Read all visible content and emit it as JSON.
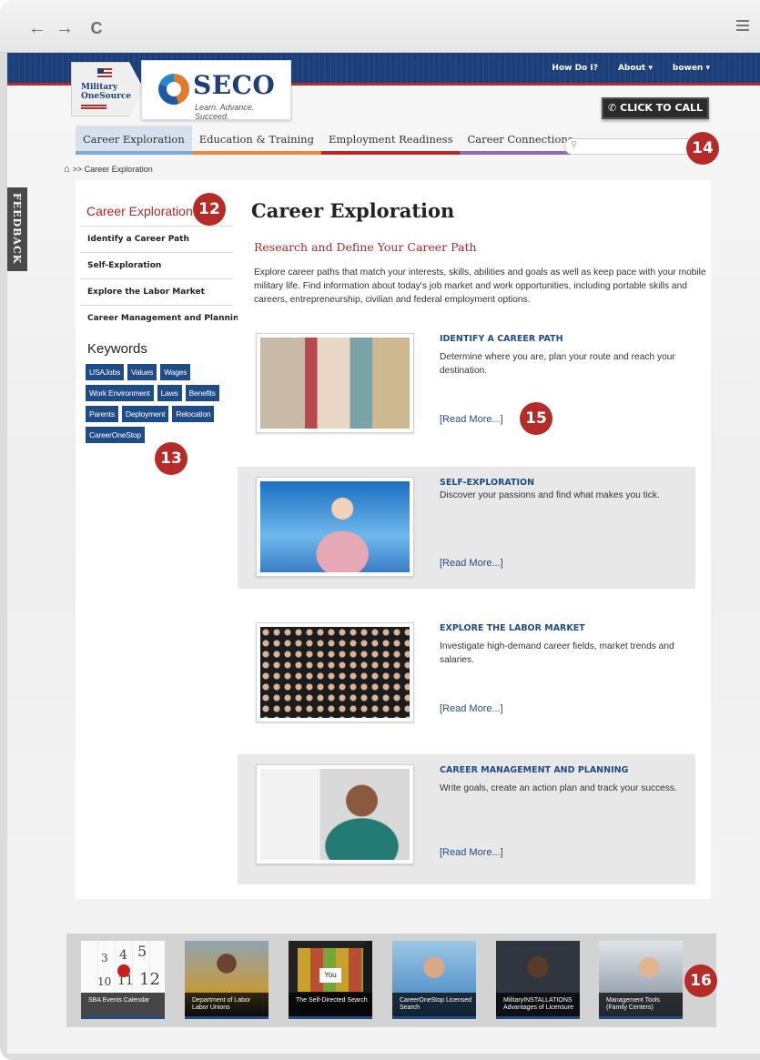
{
  "browser": {
    "back_icon": "←",
    "forward_icon": "→",
    "reload_icon": "C",
    "menu_icon": "hamburger-icon"
  },
  "topnav": {
    "how_do_i": "How Do I?",
    "about": "About ▾",
    "user": "bowen ▾"
  },
  "logos": {
    "mos_line1": "Military",
    "mos_line2": "OneSource",
    "seco_name": "SECO",
    "seco_tagline": "Learn. Advance. Succeed."
  },
  "call_button": "CLICK TO CALL",
  "tabs": [
    {
      "label": "Career Exploration",
      "color": "#7fa8d6"
    },
    {
      "label": "Education & Training",
      "color": "#e98a3a"
    },
    {
      "label": "Employment Readiness",
      "color": "#b52b27"
    },
    {
      "label": "Career Connections",
      "color": "#8e6bb3"
    }
  ],
  "search": {
    "placeholder": ""
  },
  "breadcrumb": ">> Career Exploration",
  "feedback_label": "FEEDBACK",
  "sidebar": {
    "title": "Career Exploration",
    "items": [
      "Identify a Career Path",
      "Self-Exploration",
      "Explore the Labor Market",
      "Career Management and Planning"
    ],
    "keywords_title": "Keywords",
    "keywords": [
      "USAJobs",
      "Values",
      "Wages",
      "Work Environment",
      "Laws",
      "Benefits",
      "Parents",
      "Deployment",
      "Relocation",
      "CareerOneStop"
    ]
  },
  "main": {
    "title": "Career Exploration",
    "subtitle": "Research and Define Your Career Path",
    "intro": "Explore career paths that match your interests, skills, abilities and goals as well as keep pace with your mobile military life. Find information about today's job market and work opportunities, including portable skills and careers, entrepreneurship, civilian and federal employment options.",
    "read_more": "[Read More...]",
    "cards": [
      {
        "heading": "IDENTIFY A CAREER PATH",
        "text": "Determine where you are, plan your route and reach your destination."
      },
      {
        "heading": "SELF-EXPLORATION",
        "text": "Discover your passions and find what makes you tick."
      },
      {
        "heading": "EXPLORE THE LABOR MARKET",
        "text": "Investigate high-demand career fields, market trends and salaries."
      },
      {
        "heading": "CAREER MANAGEMENT AND PLANNING",
        "text": "Write goals, create an action plan and track your success."
      }
    ]
  },
  "resources": [
    "SBA Events Calendar",
    "Department of Labor Labor Unions",
    "The Self-Directed Search",
    "CareerOneStop Licensed Search",
    "MilitaryINSTALLATIONS Advantages of Licensure",
    "Management Tools (Family Centers)"
  ],
  "calendar_numbers": [
    "3",
    "4",
    "5",
    "10",
    "11",
    "12"
  ],
  "tile_words": {
    "military": "military",
    "you": "You"
  },
  "badges": [
    "12",
    "13",
    "14",
    "15",
    "16"
  ]
}
